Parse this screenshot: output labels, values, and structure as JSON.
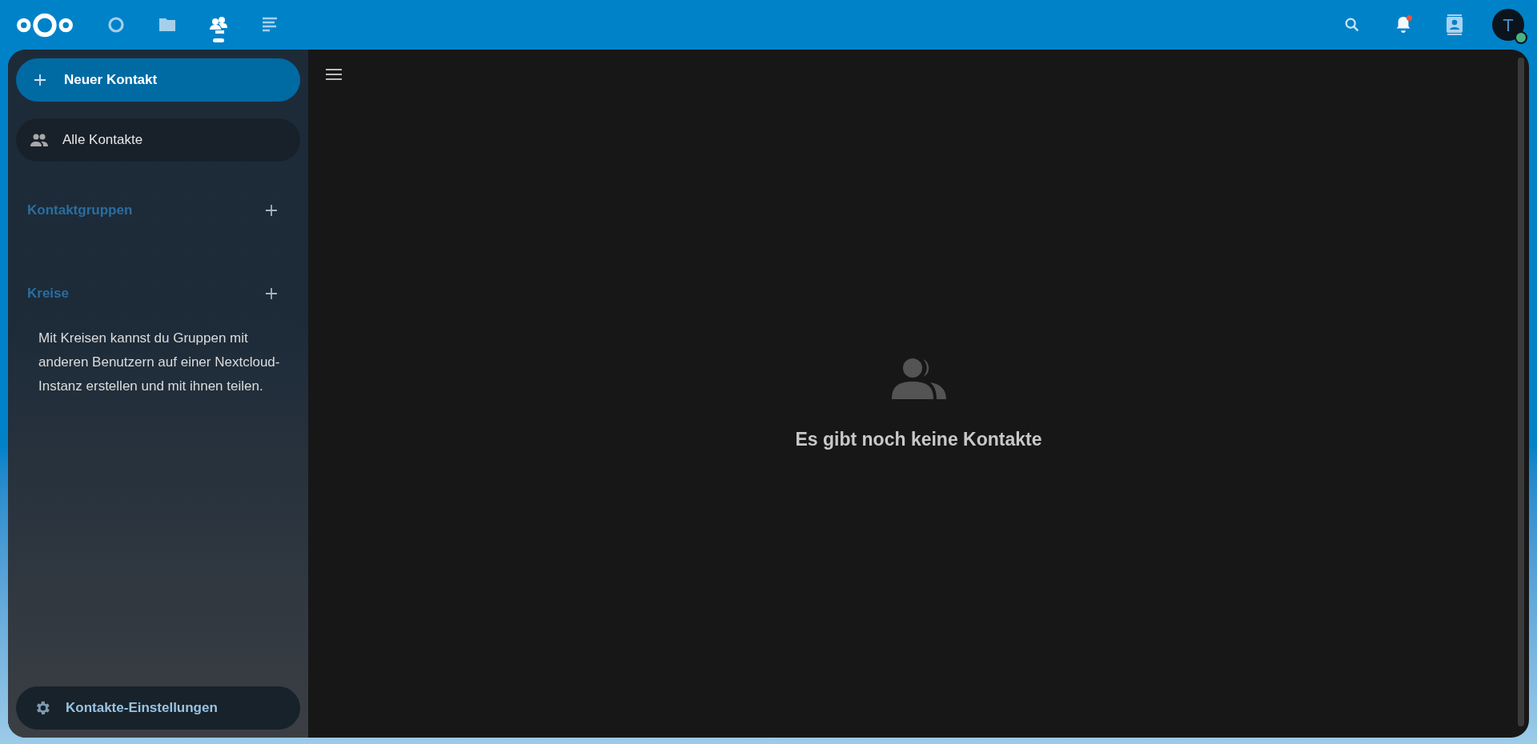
{
  "header": {
    "apps": [
      {
        "kind": "dashboard",
        "selected": false
      },
      {
        "kind": "files",
        "selected": false
      },
      {
        "kind": "contacts",
        "selected": true
      },
      {
        "kind": "activity",
        "selected": false
      }
    ],
    "notifications": {
      "has_unread": true
    },
    "avatar": {
      "initial": "T"
    }
  },
  "sidebar": {
    "new_button": "Neuer Kontakt",
    "items": [
      {
        "label": "Alle Kontakte",
        "selected": true
      }
    ],
    "sections": [
      {
        "title": "Kontaktgruppen"
      },
      {
        "title": "Kreise",
        "text": "Mit Kreisen kannst du Gruppen mit anderen Benutzern auf einer Nextcloud-Instanz erstellen und mit ihnen teilen."
      }
    ],
    "settings": "Kontakte-Einstellungen"
  },
  "main": {
    "empty_message": "Es gibt noch keine Kontakte"
  }
}
